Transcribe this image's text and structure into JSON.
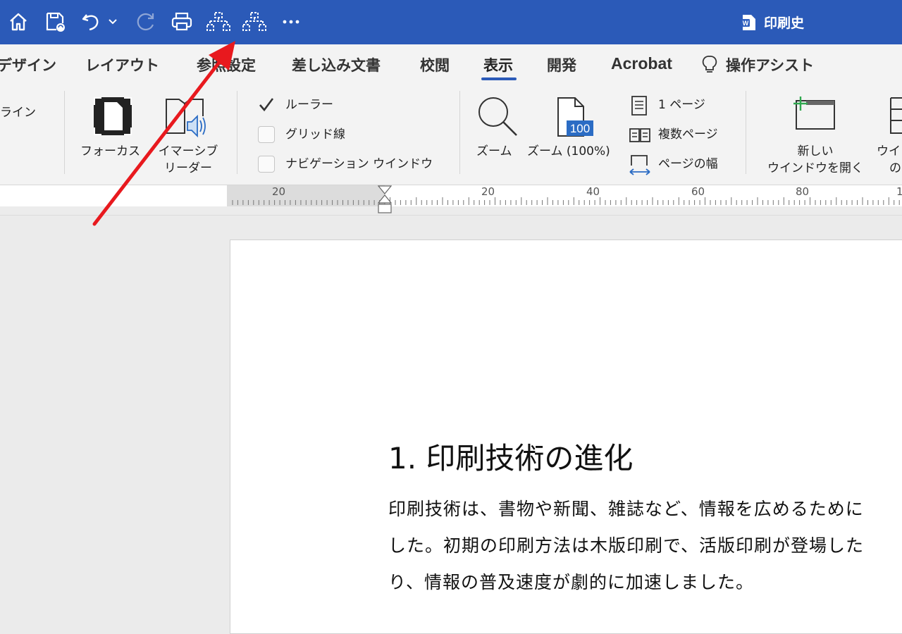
{
  "titlebar": {
    "doc_title": "印刷史",
    "bg_color": "#2b5ab8"
  },
  "tabs": [
    {
      "label": "デザイン"
    },
    {
      "label": "レイアウト"
    },
    {
      "label": "参照設定"
    },
    {
      "label": "差し込み文書"
    },
    {
      "label": "校閲"
    },
    {
      "label": "表示",
      "active": true
    },
    {
      "label": "開発"
    },
    {
      "label": "Acrobat"
    },
    {
      "label": "操作アシスト"
    }
  ],
  "ribbon": {
    "outline_partial": "ライン",
    "focus": "フォーカス",
    "immersive_line1": "イマーシブ",
    "immersive_line2": "リーダー",
    "ruler": "ルーラー",
    "gridlines": "グリッド線",
    "navigation": "ナビゲーション ウインドウ",
    "zoom": "ズーム",
    "zoom100": "ズーム (100%)",
    "zoom100_badge": "100",
    "one_page": "1 ページ",
    "multi_page": "複数ページ",
    "page_width": "ページの幅",
    "new_window_line1": "新しい",
    "new_window_line2": "ウインドウを開く",
    "arrange_partial1": "ウイ",
    "arrange_partial2": "の"
  },
  "ruler": {
    "labels": [
      "20",
      "20",
      "40",
      "60",
      "80",
      "1"
    ]
  },
  "document": {
    "heading": "1.  印刷技術の進化",
    "lines": [
      "印刷技術は、書物や新聞、雑誌など、情報を広めるために",
      "した。初期の印刷方法は木版印刷で、活版印刷が登場した",
      "り、情報の普及速度が劇的に加速しました。"
    ]
  },
  "annotation": {
    "color": "#e8191e"
  }
}
